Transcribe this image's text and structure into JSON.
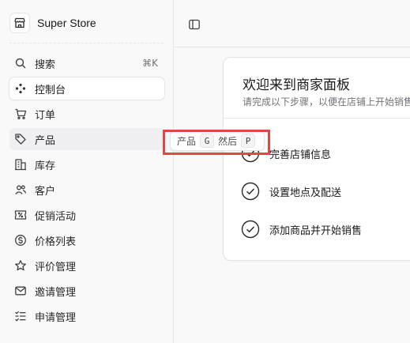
{
  "brand": {
    "name": "Super Store",
    "icon": "store-icon"
  },
  "sidebar": {
    "items": [
      {
        "key": "search",
        "label": "搜索",
        "icon": "search-icon",
        "shortcut": "⌘K"
      },
      {
        "key": "dashboard",
        "label": "控制台",
        "icon": "dashboard-icon",
        "active": true
      },
      {
        "key": "orders",
        "label": "订单",
        "icon": "cart-icon"
      },
      {
        "key": "products",
        "label": "产品",
        "icon": "tag-icon"
      },
      {
        "key": "inventory",
        "label": "库存",
        "icon": "building-icon"
      },
      {
        "key": "customers",
        "label": "客户",
        "icon": "users-icon"
      },
      {
        "key": "promotions",
        "label": "促销活动",
        "icon": "receipt-icon"
      },
      {
        "key": "price-lists",
        "label": "价格列表",
        "icon": "currency-icon"
      },
      {
        "key": "reviews",
        "label": "评价管理",
        "icon": "star-icon"
      },
      {
        "key": "invites",
        "label": "邀请管理",
        "icon": "envelope-icon"
      },
      {
        "key": "requests",
        "label": "申请管理",
        "icon": "checklist-icon"
      }
    ]
  },
  "tooltip": {
    "label": "产品",
    "key1": "G",
    "then": "然后",
    "key2": "P"
  },
  "main": {
    "title": "欢迎来到商家面板",
    "subtitle": "请完成以下步骤，以便在店铺上开始销售",
    "tasks": [
      {
        "label": "完善店铺信息"
      },
      {
        "label": "设置地点及配送"
      },
      {
        "label": "添加商品并开始销售"
      }
    ]
  },
  "colors": {
    "highlight": "#e04848",
    "background": "#f9f9fa",
    "card": "#ffffff",
    "border": "#e4e4e7"
  }
}
